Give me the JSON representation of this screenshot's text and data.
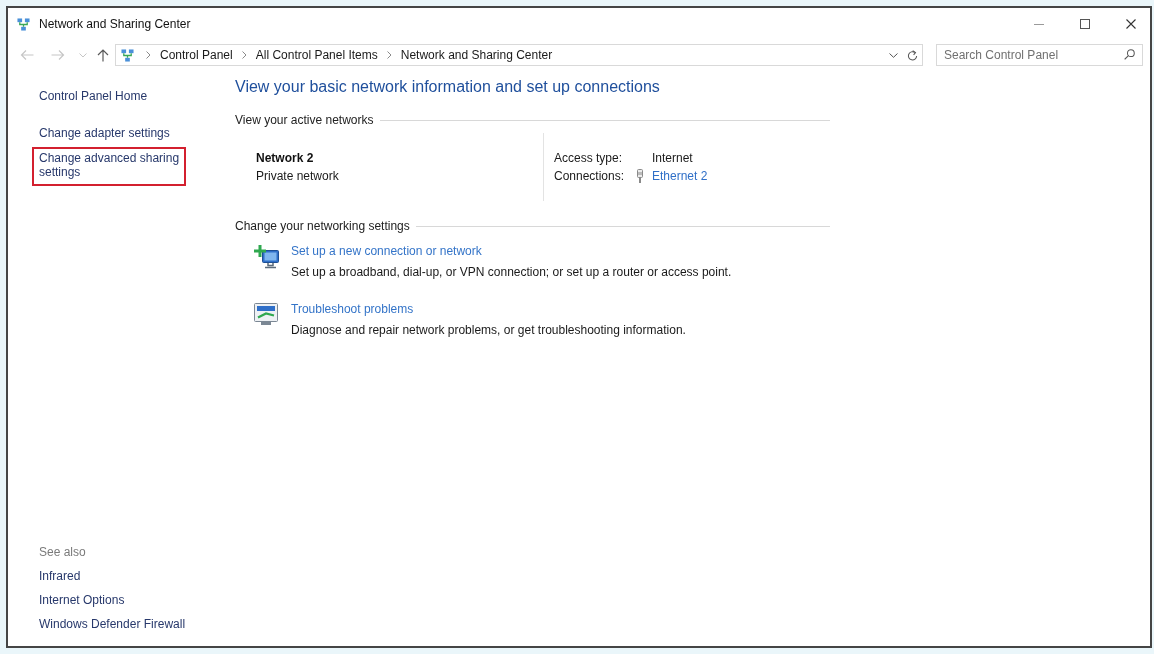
{
  "window": {
    "title": "Network and Sharing Center"
  },
  "address_bar": {
    "path": [
      "Control Panel",
      "All Control Panel Items",
      "Network and Sharing Center"
    ]
  },
  "search": {
    "placeholder": "Search Control Panel"
  },
  "sidebar": {
    "items": [
      {
        "label": "Control Panel Home",
        "highlighted": false
      },
      {
        "label": "Change adapter settings",
        "highlighted": false
      },
      {
        "label": "Change advanced sharing settings",
        "highlighted": true
      }
    ],
    "see_also": {
      "heading": "See also",
      "items": [
        "Infrared",
        "Internet Options",
        "Windows Defender Firewall"
      ]
    }
  },
  "main": {
    "heading": "View your basic network information and set up connections",
    "active_networks": {
      "heading": "View your active networks",
      "networks": [
        {
          "name": "Network 2",
          "category": "Private network",
          "access_type_label": "Access type:",
          "access_type": "Internet",
          "connections_label": "Connections:",
          "connection": "Ethernet 2"
        }
      ]
    },
    "settings": {
      "heading": "Change your networking settings",
      "tasks": [
        {
          "kind": "new_connection",
          "link": "Set up a new connection or network",
          "description": "Set up a broadband, dial-up, or VPN connection; or set up a router or access point."
        },
        {
          "kind": "troubleshoot",
          "link": "Troubleshoot problems",
          "description": "Diagnose and repair network problems, or get troubleshooting information."
        }
      ]
    }
  }
}
